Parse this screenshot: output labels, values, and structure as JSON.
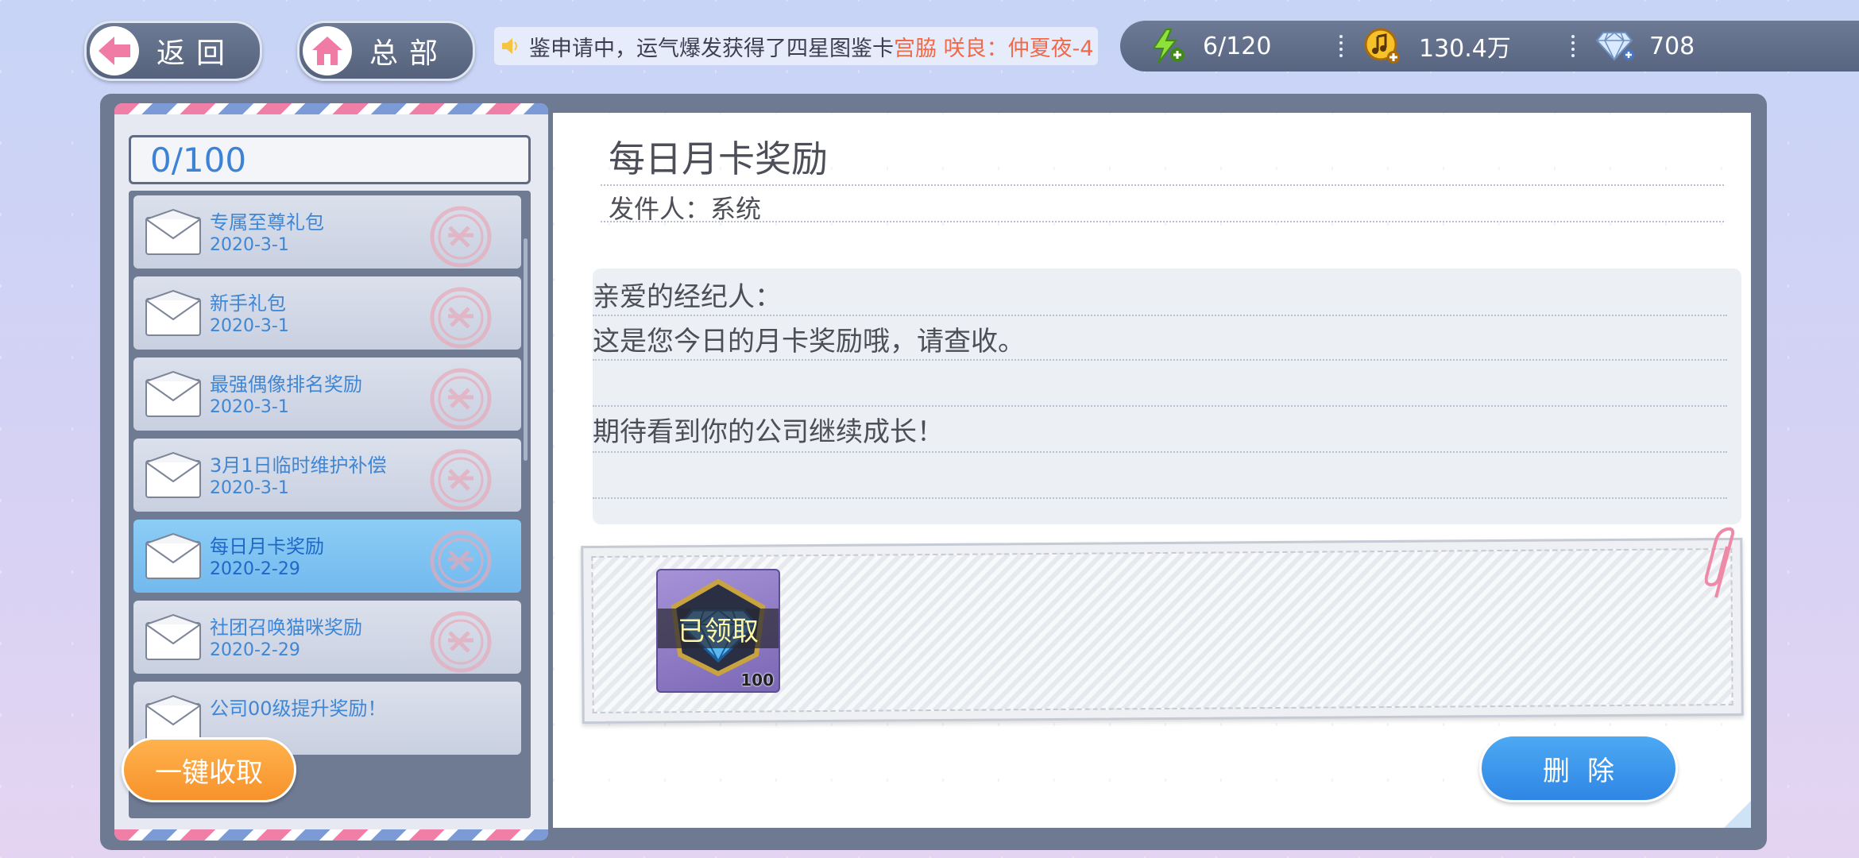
{
  "topbar": {
    "back_label": "返回",
    "hq_label": "总部",
    "ticker_text": "鉴申请中，运气爆发获得了四星图鉴卡",
    "ticker_highlight": "宫脇 咲良：仲夏夜-4",
    "stamina": "6/120",
    "coins": "130.4万",
    "diamonds": "708"
  },
  "mailbox": {
    "count": "0/100",
    "items": [
      {
        "title": "专属至尊礼包",
        "date": "2020-3-1"
      },
      {
        "title": "新手礼包",
        "date": "2020-3-1"
      },
      {
        "title": "最强偶像排名奖励",
        "date": "2020-3-1"
      },
      {
        "title": "3月1日临时维护补偿",
        "date": "2020-3-1"
      },
      {
        "title": "每日月卡奖励",
        "date": "2020-2-29"
      },
      {
        "title": "社团召唤猫咪奖励",
        "date": "2020-2-29"
      },
      {
        "title": "公司00级提升奖励！",
        "date": ""
      }
    ],
    "collect_all_label": "一键收取"
  },
  "detail": {
    "title": "每日月卡奖励",
    "sender": "发件人：系统",
    "body": {
      "greeting": "亲爱的经纪人：",
      "line1": "这是您今日的月卡奖励哦，请查收。",
      "line2": "期待看到你的公司继续成长！"
    },
    "reward": {
      "status": "已领取",
      "quantity": "100"
    },
    "delete_label": "删除"
  },
  "colors": {
    "accent_blue": "#2f86e4",
    "accent_orange": "#f7922b",
    "highlight_text": "#f06a4a",
    "selected_item": "#72b9ee"
  }
}
